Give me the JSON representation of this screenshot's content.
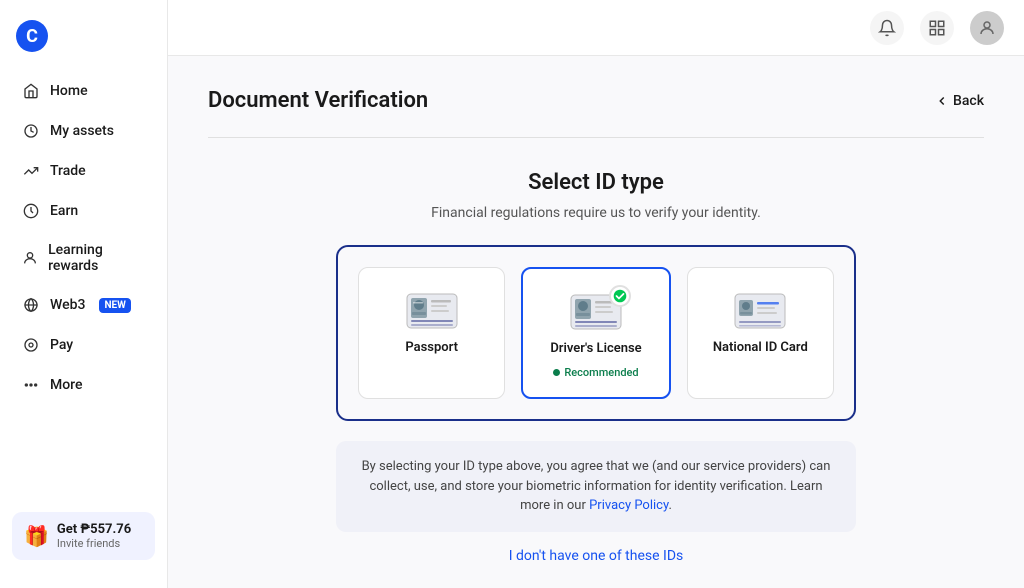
{
  "app": {
    "logo_letter": "C"
  },
  "sidebar": {
    "nav_items": [
      {
        "id": "home",
        "label": "Home",
        "icon": "home"
      },
      {
        "id": "my-assets",
        "label": "My assets",
        "icon": "assets"
      },
      {
        "id": "trade",
        "label": "Trade",
        "icon": "trade"
      },
      {
        "id": "earn",
        "label": "Earn",
        "icon": "earn"
      },
      {
        "id": "learning-rewards",
        "label": "Learning rewards",
        "icon": "learning"
      },
      {
        "id": "web3",
        "label": "Web3",
        "icon": "web3",
        "badge": "NEW"
      },
      {
        "id": "pay",
        "label": "Pay",
        "icon": "pay"
      },
      {
        "id": "more",
        "label": "More",
        "icon": "more"
      }
    ],
    "invite": {
      "amount": "Get ₱557.76",
      "label": "Invite friends"
    }
  },
  "topbar": {
    "bell_icon": "bell",
    "grid_icon": "grid",
    "avatar_icon": "user"
  },
  "page": {
    "title": "Document Verification",
    "back_label": "Back",
    "select_id": {
      "title": "Select ID type",
      "subtitle": "Financial regulations require us to verify your identity.",
      "id_types": [
        {
          "id": "passport",
          "label": "Passport",
          "selected": false,
          "recommended": false
        },
        {
          "id": "drivers-license",
          "label": "Driver's License",
          "selected": true,
          "recommended": true,
          "recommended_label": "Recommended"
        },
        {
          "id": "national-id",
          "label": "National ID Card",
          "selected": false,
          "recommended": false
        }
      ],
      "notice_text": "By selecting your ID type above, you agree that we (and our service providers) can collect, use, and store your biometric information for identity verification. Learn more in our ",
      "notice_link_text": "Privacy Policy",
      "notice_suffix": ".",
      "no_id_link": "I don't have one of these IDs"
    }
  }
}
